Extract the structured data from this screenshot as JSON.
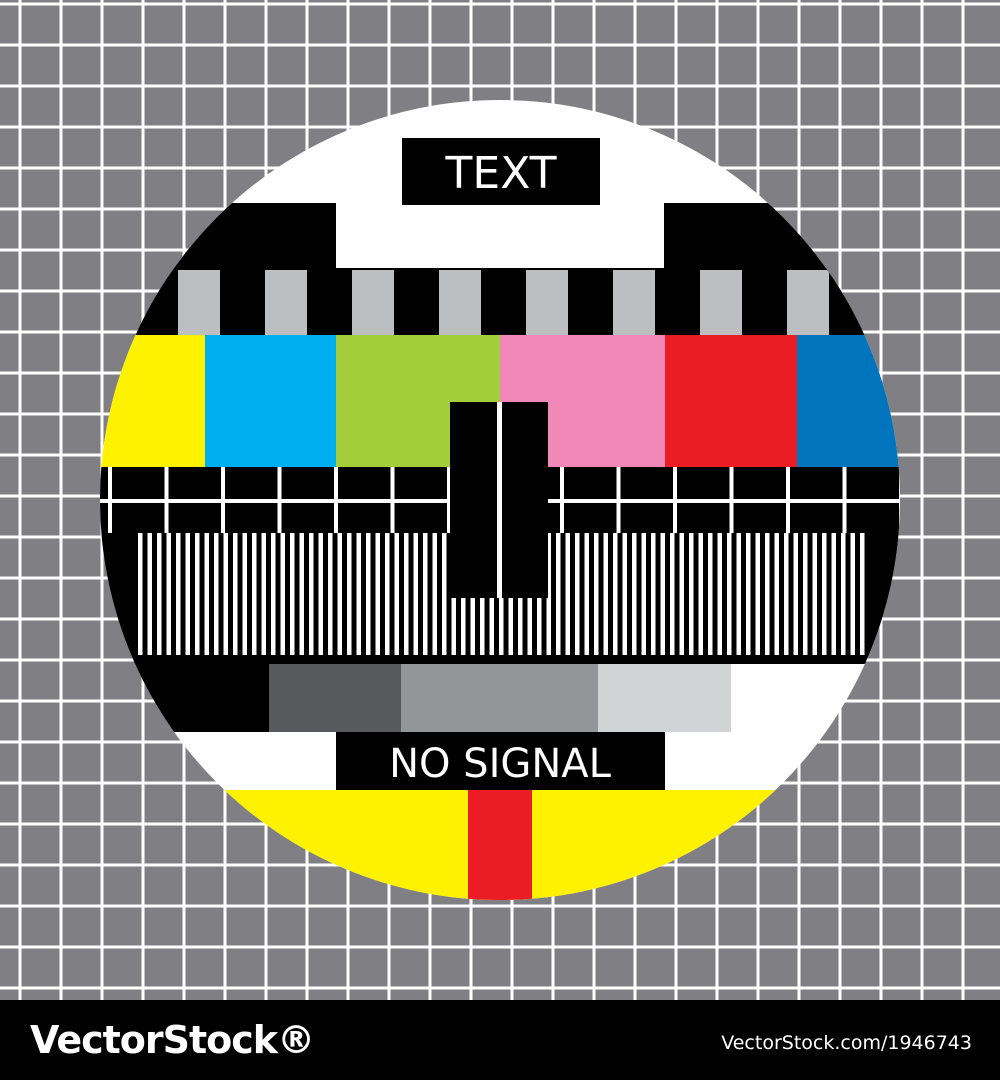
{
  "card": {
    "top_label": "TEXT",
    "bottom_label": "NO SIGNAL"
  },
  "footer": {
    "logo_text": "VectorStock®",
    "url_text": "VectorStock.com/1946743"
  },
  "colors": {
    "background_grey": "#808084",
    "grid_line": "#ffffff",
    "yellow": "#fef200",
    "cyan": "#00adef",
    "green": "#a3cd3a",
    "pink": "#f188b7",
    "red": "#ec1c24",
    "blue": "#0074bd",
    "grey_light": "#bcbec0",
    "grey_dark": "#58595b",
    "grey_mid": "#939598",
    "grey_pale": "#d1d3d4"
  }
}
